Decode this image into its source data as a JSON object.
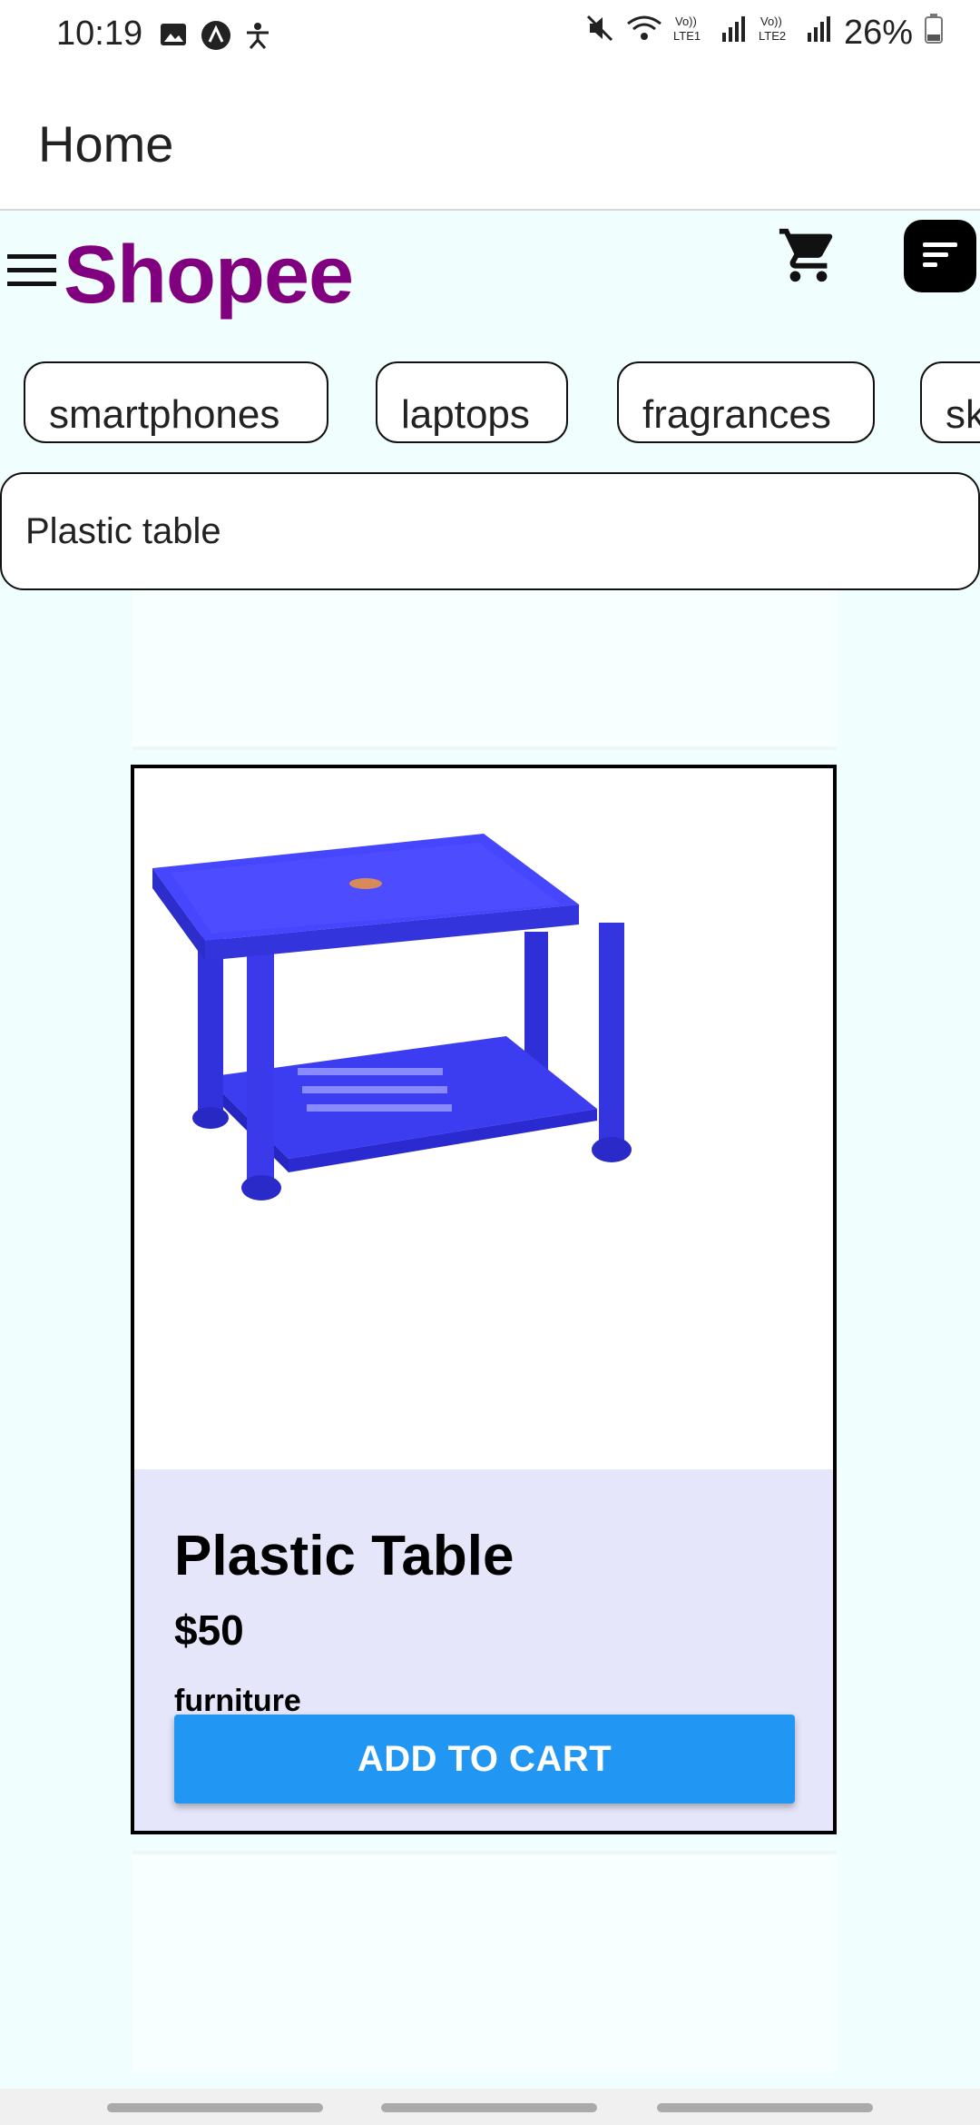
{
  "status_bar": {
    "time": "10:19",
    "battery": "26%",
    "left_icons": [
      "image-icon",
      "app-icon",
      "accessibility-icon"
    ],
    "right_icons": [
      "mute-icon",
      "wifi-icon",
      "volte-lte1-icon",
      "signal-icon",
      "volte-lte2-icon",
      "signal-icon",
      "battery-icon"
    ]
  },
  "app_bar": {
    "title": "Home"
  },
  "header": {
    "brand": "Shopee",
    "brand_color": "#800080"
  },
  "categories": [
    "smartphones",
    "laptops",
    "fragrances",
    "sk"
  ],
  "search": {
    "value": "Plastic table"
  },
  "product": {
    "name": "Plastic Table",
    "price": "$50",
    "category": "furniture",
    "button_label": "ADD TO CART",
    "image_color": "#3a3af0"
  }
}
